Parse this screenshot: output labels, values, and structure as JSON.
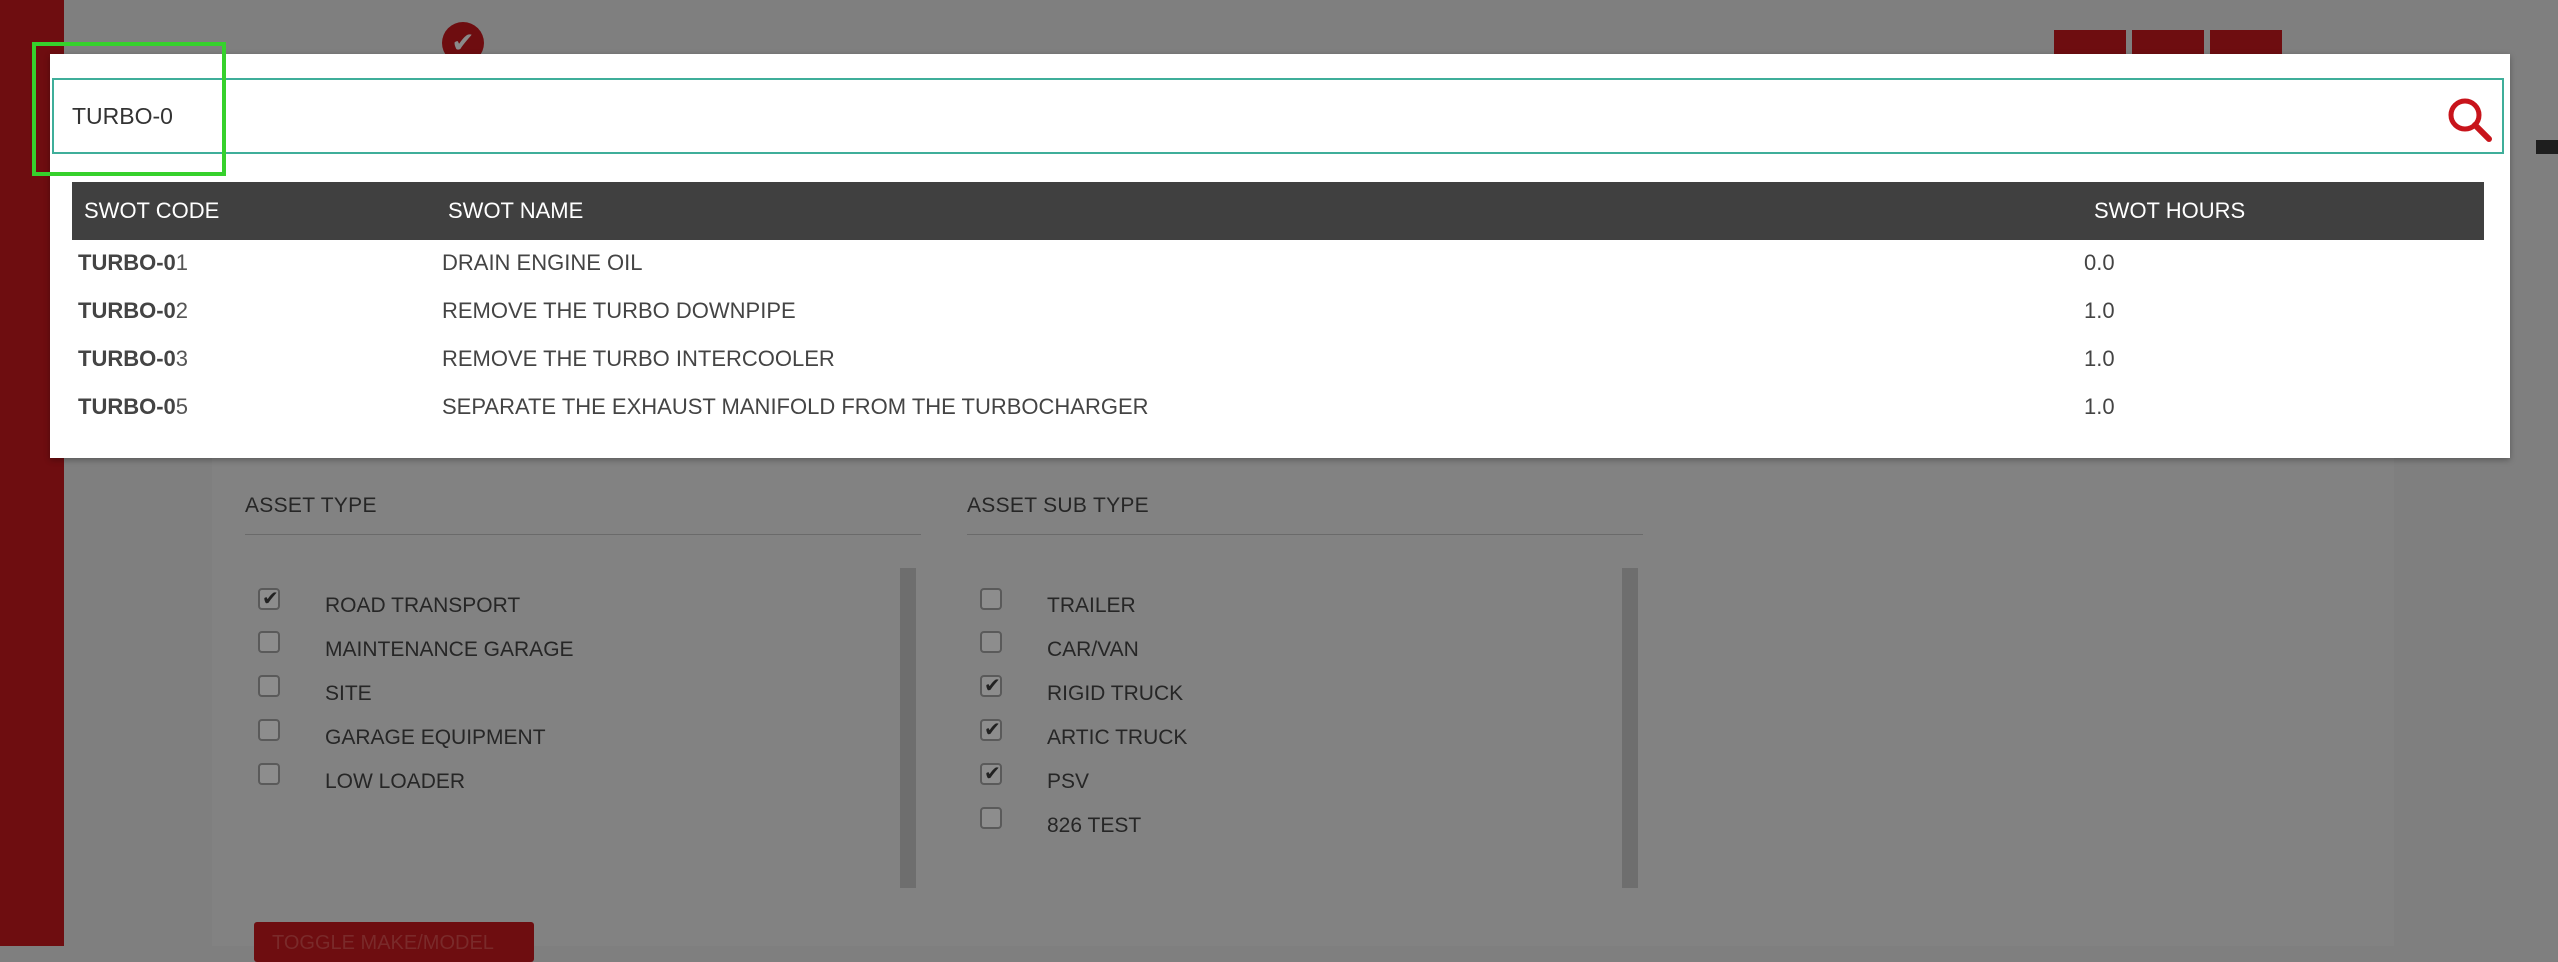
{
  "search": {
    "value": "TURBO-0"
  },
  "results": {
    "headers": {
      "code": "SWOT CODE",
      "name": "SWOT NAME",
      "hours": "SWOT HOURS"
    },
    "rows": [
      {
        "code_match": "TURBO-0",
        "code_rest": "1",
        "name": "DRAIN ENGINE OIL",
        "hours": "0.0"
      },
      {
        "code_match": "TURBO-0",
        "code_rest": "2",
        "name": "REMOVE THE TURBO DOWNPIPE",
        "hours": "1.0"
      },
      {
        "code_match": "TURBO-0",
        "code_rest": "3",
        "name": "REMOVE THE TURBO INTERCOOLER",
        "hours": "1.0"
      },
      {
        "code_match": "TURBO-0",
        "code_rest": "5",
        "name": "SEPARATE THE EXHAUST MANIFOLD FROM THE TURBOCHARGER",
        "hours": "1.0"
      }
    ]
  },
  "background": {
    "asset_type": {
      "title": "ASSET TYPE",
      "options": [
        {
          "label": "ROAD TRANSPORT",
          "checked": true
        },
        {
          "label": "MAINTENANCE GARAGE",
          "checked": false
        },
        {
          "label": "SITE",
          "checked": false
        },
        {
          "label": "GARAGE EQUIPMENT",
          "checked": false
        },
        {
          "label": "LOW LOADER",
          "checked": false
        }
      ]
    },
    "asset_sub_type": {
      "title": "ASSET SUB TYPE",
      "options": [
        {
          "label": "TRAILER",
          "checked": false
        },
        {
          "label": "CAR/VAN",
          "checked": false
        },
        {
          "label": "RIGID TRUCK",
          "checked": true
        },
        {
          "label": "ARTIC TRUCK",
          "checked": true
        },
        {
          "label": "PSV",
          "checked": true
        },
        {
          "label": "826 TEST",
          "checked": false
        }
      ]
    },
    "toggle_button": "TOGGLE MAKE/MODEL"
  },
  "colors": {
    "overlay": "#7f7f7f",
    "brand_red": "#6e0d10",
    "search_border": "#3fae9a",
    "search_icon": "#c8141b",
    "header_bg": "#404040",
    "highlight": "#36d12c"
  },
  "icons": {
    "search": "search-icon",
    "checkmark": "checkmark-icon"
  }
}
